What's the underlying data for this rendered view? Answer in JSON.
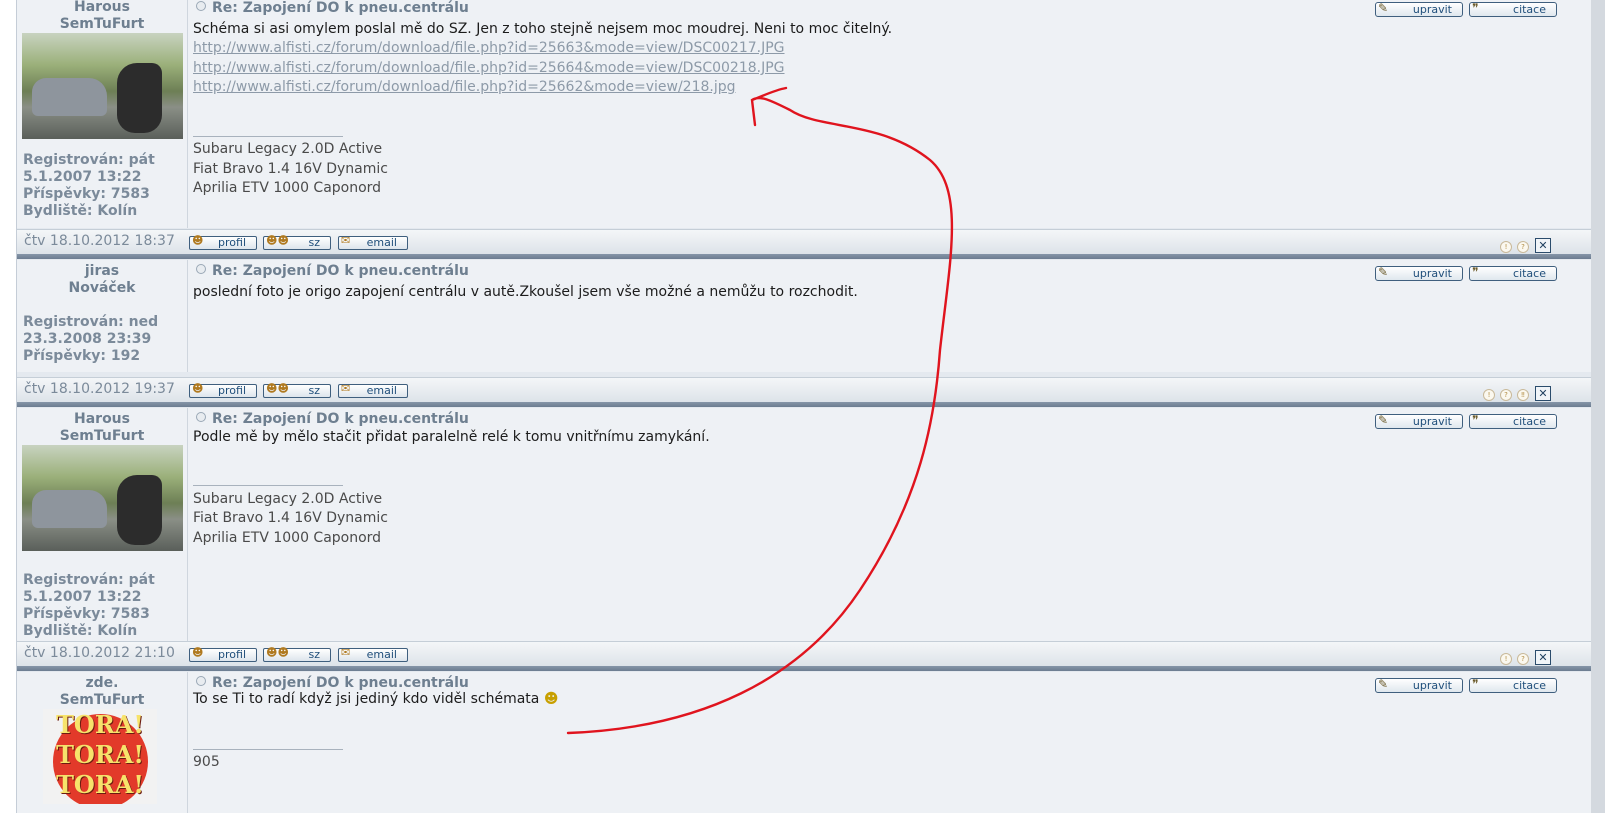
{
  "posts": [
    {
      "username": "Harous",
      "rank": "SemTuFurt",
      "registered_label": "Registrován: pát",
      "registered_date": "5.1.2007 13:22",
      "posts_label": "Příspěvky: 7583",
      "location_label": "Bydliště: Kolín",
      "subject": "Re: Zapojení DO k pneu.centrálu",
      "body_lines": [
        "Schéma si asi omylem poslal mě do SZ. Jen z toho stejně nejsem moc moudrej. Neni to moc čitelný."
      ],
      "links": [
        "http://www.alfisti.cz/forum/download/file.php?id=25663&mode=view/DSC00217.JPG",
        "http://www.alfisti.cz/forum/download/file.php?id=25664&mode=view/DSC00218.JPG",
        "http://www.alfisti.cz/forum/download/file.php?id=25662&mode=view/218.jpg"
      ],
      "signature": [
        "Subaru Legacy 2.0D Active",
        "Fiat Bravo 1.4 16V Dynamic",
        "Aprilia ETV 1000 Caponord"
      ],
      "date": "čtv 18.10.2012 18:37"
    },
    {
      "username": "jiras",
      "rank": "Nováček",
      "registered_label": "Registrován: ned",
      "registered_date": "23.3.2008 23:39",
      "posts_label": "Příspěvky: 192",
      "subject": "Re: Zapojení DO k pneu.centrálu",
      "body_lines": [
        "poslední foto je origo zapojení centrálu v autě.Zkoušel jsem vše možné a nemůžu to rozchodit."
      ],
      "date": "čtv 18.10.2012 19:37"
    },
    {
      "username": "Harous",
      "rank": "SemTuFurt",
      "registered_label": "Registrován: pát",
      "registered_date": "5.1.2007 13:22",
      "posts_label": "Příspěvky: 7583",
      "location_label": "Bydliště: Kolín",
      "subject": "Re: Zapojení DO k pneu.centrálu",
      "body_lines": [
        "Podle mě by mělo stačit přidat paralelně relé k tomu vnitřnímu zamykání."
      ],
      "signature": [
        "Subaru Legacy 2.0D Active",
        "Fiat Bravo 1.4 16V Dynamic",
        "Aprilia ETV 1000 Caponord"
      ],
      "date": "čtv 18.10.2012 21:10"
    },
    {
      "username": "zde.",
      "rank": "SemTuFurt",
      "avatar_text": [
        "TORA!",
        "TORA!",
        "TORA!"
      ],
      "subject": "Re: Zapojení DO k pneu.centrálu",
      "body_lines": [
        "To se Ti to radí když jsi jediný kdo viděl schémata"
      ],
      "signature": [
        "905"
      ]
    }
  ],
  "buttons": {
    "edit": "upravit",
    "quote": "citace",
    "profile": "profil",
    "pm": "sz",
    "email": "email"
  },
  "icons": {
    "edit": "edit-pencil-icon",
    "quote": "quote-bubble-icon",
    "profile": "profile-person-icon",
    "pm": "private-message-icon",
    "email": "email-envelope-icon",
    "smiley": "smiley-icon"
  },
  "colors": {
    "annotation": "#e0141e",
    "link": "#8d9aa8",
    "username": "#6e7f90",
    "separator": "#6c7d91"
  }
}
